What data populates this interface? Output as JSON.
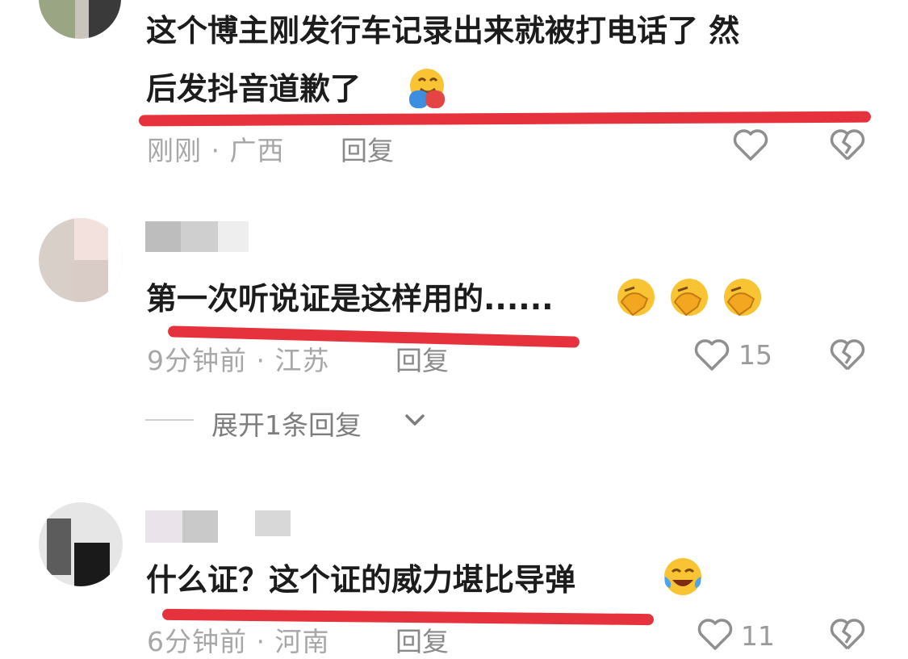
{
  "comments": [
    {
      "text_line1": "这个博主刚发行车记录出来就被打电话了 然",
      "text_line2": "后发抖音道歉了",
      "emoji": "hugging-face",
      "meta": "刚刚 · 广西",
      "reply_label": "回复",
      "like_count": ""
    },
    {
      "text": "第一次听说证是这样用的......",
      "emoji": "face-palm",
      "meta": "9分钟前 · 江苏",
      "reply_label": "回复",
      "like_count": "15",
      "expand_label": "展开1条回复"
    },
    {
      "text": "什么证？这个证的威力堪比导弹",
      "emoji": "crying-laughing-face",
      "meta": "6分钟前 · 河南",
      "reply_label": "回复",
      "like_count": "11"
    }
  ],
  "colors": {
    "underline": "#e5323c",
    "meta_text": "#a7a7a7",
    "body_text": "#1c1c1c"
  }
}
